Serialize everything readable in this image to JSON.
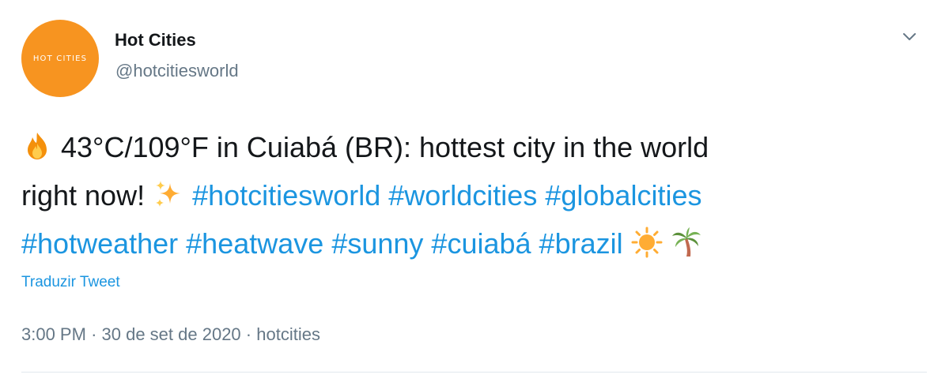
{
  "author": {
    "display_name": "Hot Cities",
    "handle": "@hotcitiesworld",
    "avatar_text": "HOT CITIES",
    "avatar_color": "#f79420"
  },
  "tweet": {
    "line1_text": "43°C/109°F in Cuiabá (BR): hottest city in the world",
    "line2_text": "right now!",
    "hashtags": [
      "#hotcitiesworld",
      "#worldcities",
      "#globalcities",
      "#hotweather",
      "#heatwave",
      "#sunny",
      "#cuiabá",
      "#brazil"
    ],
    "emojis": [
      "fire-icon",
      "sparkles-icon",
      "sun-icon",
      "palm-tree-icon"
    ]
  },
  "translate_label": "Traduzir Tweet",
  "meta": {
    "time": "3:00 PM",
    "separator": "·",
    "date": "30 de set de 2020",
    "source": "hotcities"
  },
  "colors": {
    "link": "#1b95e0",
    "text": "#14171a",
    "muted": "#657786",
    "divider": "#e1e8ed"
  }
}
